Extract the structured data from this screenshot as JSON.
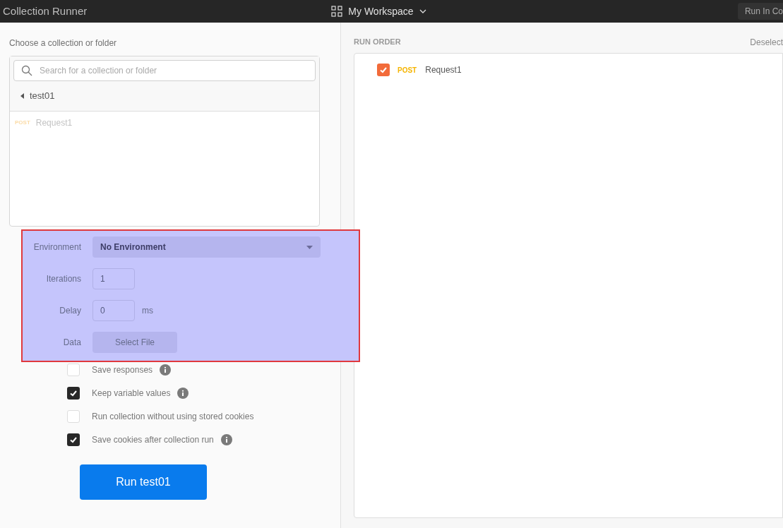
{
  "header": {
    "title": "Collection Runner",
    "workspace": "My Workspace",
    "button": "Run In Co"
  },
  "chooser": {
    "label": "Choose a collection or folder",
    "search": {
      "placeholder": "Search for a collection or folder"
    },
    "folder": {
      "name": "test01"
    },
    "requests": [
      {
        "method": "POST",
        "name": "Request1",
        "disabled": true
      }
    ]
  },
  "settings": {
    "highlighted": true,
    "fields": [
      {
        "kind": "select",
        "label": "Environment",
        "value": "No Environment"
      },
      {
        "kind": "input",
        "label": "Iterations",
        "value": "1"
      },
      {
        "kind": "input",
        "label": "Delay",
        "value": "0",
        "unit": "ms"
      },
      {
        "kind": "file",
        "label": "Data",
        "button": "Select File"
      }
    ]
  },
  "options": [
    {
      "label": "Save responses",
      "checked": false,
      "info": true
    },
    {
      "label": "Keep variable values",
      "checked": true,
      "info": true
    },
    {
      "label": "Run collection without using stored cookies",
      "checked": false,
      "info": false
    },
    {
      "label": "Save cookies after collection run",
      "checked": true,
      "info": true
    }
  ],
  "run_button": "Run test01",
  "run_order": {
    "title": "RUN ORDER",
    "action": "Deselect",
    "items": [
      {
        "method": "POST",
        "name": "Request1",
        "checked": true
      }
    ]
  }
}
